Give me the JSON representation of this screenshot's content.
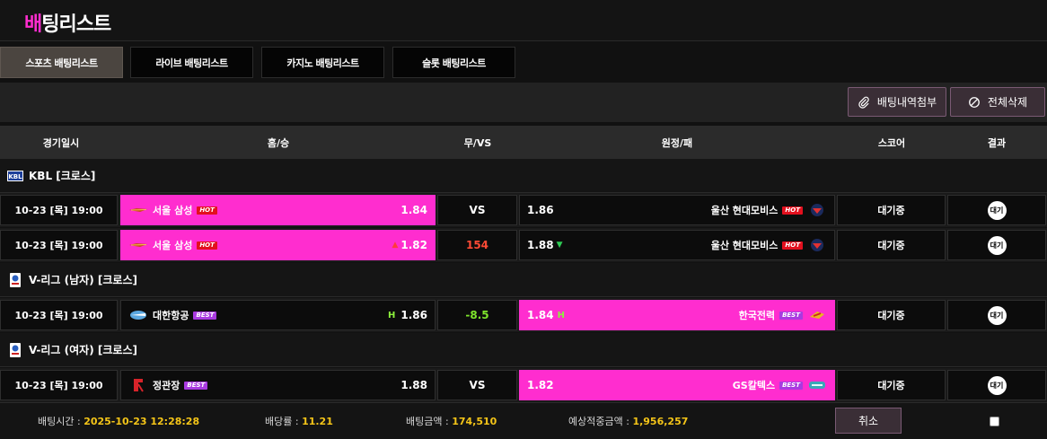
{
  "page": {
    "title_accent": "배",
    "title_rest": "팅리스트"
  },
  "tabs": [
    {
      "label": "스포츠 배팅리스트",
      "active": true
    },
    {
      "label": "라이브 배팅리스트",
      "active": false
    },
    {
      "label": "카지노 배팅리스트",
      "active": false
    },
    {
      "label": "슬롯 배팅리스트",
      "active": false
    }
  ],
  "toolbar": {
    "attach_label": "배팅내역첨부",
    "delete_all_label": "전체삭제"
  },
  "columns": [
    "경기일시",
    "홈/승",
    "무/VS",
    "원정/패",
    "스코어",
    "결과"
  ],
  "leagues": [
    {
      "name": "KBL [크로스]"
    },
    {
      "name": "V-리그 (남자) [크로스]"
    },
    {
      "name": "V-리그 (여자) [크로스]"
    }
  ],
  "rows": [
    {
      "date": "10-23 [목] 19:00",
      "home": "서울 삼성",
      "home_badge": "HOT",
      "home_odds": "1.84",
      "mid": "VS",
      "away_odds": "1.86",
      "away": "울산 현대모비스",
      "away_badge": "HOT",
      "status": "대기중",
      "result": "대기",
      "selected": "home"
    },
    {
      "date": "10-23 [목] 19:00",
      "home": "서울 삼성",
      "home_badge": "HOT",
      "home_odds": "1.82",
      "mid": "154",
      "away_odds": "1.88",
      "away": "울산 현대모비스",
      "away_badge": "HOT",
      "status": "대기중",
      "result": "대기",
      "selected": "home"
    },
    {
      "date": "10-23 [목] 19:00",
      "home": "대한항공",
      "home_badge": "BEST",
      "home_odds": "1.86",
      "home_mark": "H",
      "mid": "-8.5",
      "away_odds": "1.84",
      "away_mark": "H",
      "away": "한국전력",
      "away_badge": "BEST",
      "status": "대기중",
      "result": "대기",
      "selected": "away"
    },
    {
      "date": "10-23 [목] 19:00",
      "home": "정관장",
      "home_badge": "BEST",
      "home_odds": "1.88",
      "mid": "VS",
      "away_odds": "1.82",
      "away": "GS칼텍스",
      "away_badge": "BEST",
      "status": "대기중",
      "result": "대기",
      "selected": "away"
    }
  ],
  "footer": {
    "bet_time_label": "배팅시간 :",
    "bet_time": "2025-10-23 12:28:28",
    "odds_label": "배당률 :",
    "odds": "11.21",
    "amount_label": "배팅금액 :",
    "amount": "174,510",
    "expected_label": "예상적중금액 :",
    "expected": "1,956,257",
    "cancel_label": "취소"
  },
  "colors": {
    "accent": "#ff2dcf",
    "hot": "#e3101e",
    "best": "#a93ae0",
    "value": "#f5c518"
  }
}
